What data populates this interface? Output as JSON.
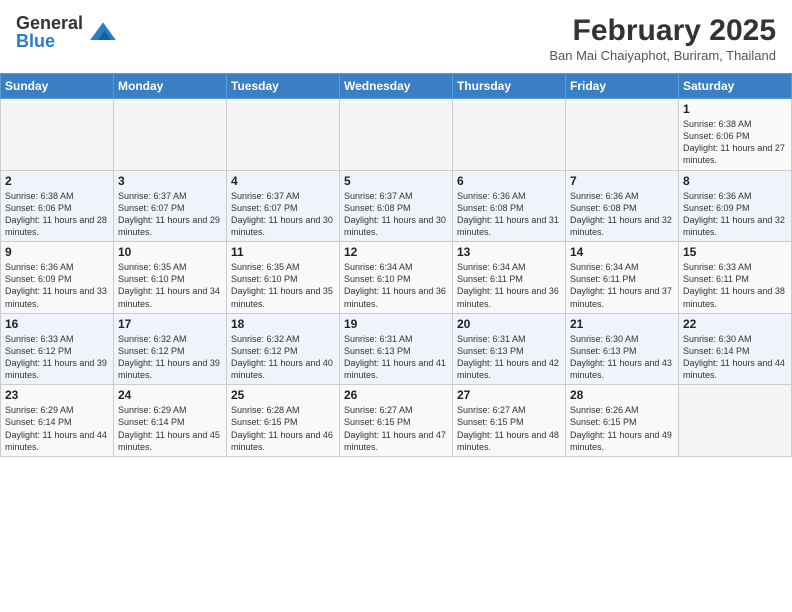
{
  "header": {
    "logo_general": "General",
    "logo_blue": "Blue",
    "month_year": "February 2025",
    "location": "Ban Mai Chaiyaphot, Buriram, Thailand"
  },
  "weekdays": [
    "Sunday",
    "Monday",
    "Tuesday",
    "Wednesday",
    "Thursday",
    "Friday",
    "Saturday"
  ],
  "weeks": [
    [
      {
        "day": "",
        "info": ""
      },
      {
        "day": "",
        "info": ""
      },
      {
        "day": "",
        "info": ""
      },
      {
        "day": "",
        "info": ""
      },
      {
        "day": "",
        "info": ""
      },
      {
        "day": "",
        "info": ""
      },
      {
        "day": "1",
        "info": "Sunrise: 6:38 AM\nSunset: 6:06 PM\nDaylight: 11 hours and 27 minutes."
      }
    ],
    [
      {
        "day": "2",
        "info": "Sunrise: 6:38 AM\nSunset: 6:06 PM\nDaylight: 11 hours and 28 minutes."
      },
      {
        "day": "3",
        "info": "Sunrise: 6:37 AM\nSunset: 6:07 PM\nDaylight: 11 hours and 29 minutes."
      },
      {
        "day": "4",
        "info": "Sunrise: 6:37 AM\nSunset: 6:07 PM\nDaylight: 11 hours and 30 minutes."
      },
      {
        "day": "5",
        "info": "Sunrise: 6:37 AM\nSunset: 6:08 PM\nDaylight: 11 hours and 30 minutes."
      },
      {
        "day": "6",
        "info": "Sunrise: 6:36 AM\nSunset: 6:08 PM\nDaylight: 11 hours and 31 minutes."
      },
      {
        "day": "7",
        "info": "Sunrise: 6:36 AM\nSunset: 6:08 PM\nDaylight: 11 hours and 32 minutes."
      },
      {
        "day": "8",
        "info": "Sunrise: 6:36 AM\nSunset: 6:09 PM\nDaylight: 11 hours and 32 minutes."
      }
    ],
    [
      {
        "day": "9",
        "info": "Sunrise: 6:36 AM\nSunset: 6:09 PM\nDaylight: 11 hours and 33 minutes."
      },
      {
        "day": "10",
        "info": "Sunrise: 6:35 AM\nSunset: 6:10 PM\nDaylight: 11 hours and 34 minutes."
      },
      {
        "day": "11",
        "info": "Sunrise: 6:35 AM\nSunset: 6:10 PM\nDaylight: 11 hours and 35 minutes."
      },
      {
        "day": "12",
        "info": "Sunrise: 6:34 AM\nSunset: 6:10 PM\nDaylight: 11 hours and 36 minutes."
      },
      {
        "day": "13",
        "info": "Sunrise: 6:34 AM\nSunset: 6:11 PM\nDaylight: 11 hours and 36 minutes."
      },
      {
        "day": "14",
        "info": "Sunrise: 6:34 AM\nSunset: 6:11 PM\nDaylight: 11 hours and 37 minutes."
      },
      {
        "day": "15",
        "info": "Sunrise: 6:33 AM\nSunset: 6:11 PM\nDaylight: 11 hours and 38 minutes."
      }
    ],
    [
      {
        "day": "16",
        "info": "Sunrise: 6:33 AM\nSunset: 6:12 PM\nDaylight: 11 hours and 39 minutes."
      },
      {
        "day": "17",
        "info": "Sunrise: 6:32 AM\nSunset: 6:12 PM\nDaylight: 11 hours and 39 minutes."
      },
      {
        "day": "18",
        "info": "Sunrise: 6:32 AM\nSunset: 6:12 PM\nDaylight: 11 hours and 40 minutes."
      },
      {
        "day": "19",
        "info": "Sunrise: 6:31 AM\nSunset: 6:13 PM\nDaylight: 11 hours and 41 minutes."
      },
      {
        "day": "20",
        "info": "Sunrise: 6:31 AM\nSunset: 6:13 PM\nDaylight: 11 hours and 42 minutes."
      },
      {
        "day": "21",
        "info": "Sunrise: 6:30 AM\nSunset: 6:13 PM\nDaylight: 11 hours and 43 minutes."
      },
      {
        "day": "22",
        "info": "Sunrise: 6:30 AM\nSunset: 6:14 PM\nDaylight: 11 hours and 44 minutes."
      }
    ],
    [
      {
        "day": "23",
        "info": "Sunrise: 6:29 AM\nSunset: 6:14 PM\nDaylight: 11 hours and 44 minutes."
      },
      {
        "day": "24",
        "info": "Sunrise: 6:29 AM\nSunset: 6:14 PM\nDaylight: 11 hours and 45 minutes."
      },
      {
        "day": "25",
        "info": "Sunrise: 6:28 AM\nSunset: 6:15 PM\nDaylight: 11 hours and 46 minutes."
      },
      {
        "day": "26",
        "info": "Sunrise: 6:27 AM\nSunset: 6:15 PM\nDaylight: 11 hours and 47 minutes."
      },
      {
        "day": "27",
        "info": "Sunrise: 6:27 AM\nSunset: 6:15 PM\nDaylight: 11 hours and 48 minutes."
      },
      {
        "day": "28",
        "info": "Sunrise: 6:26 AM\nSunset: 6:15 PM\nDaylight: 11 hours and 49 minutes."
      },
      {
        "day": "",
        "info": ""
      }
    ]
  ]
}
